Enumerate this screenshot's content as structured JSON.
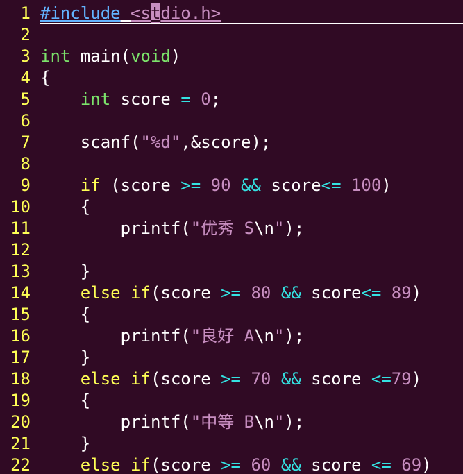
{
  "editor": {
    "lines": [
      {
        "num": "1",
        "cursorline": true,
        "tokens": [
          {
            "t": "#include",
            "k": "preproc",
            "ul": true
          },
          {
            "t": " ",
            "k": "plain",
            "ul": true
          },
          {
            "t": "<s",
            "k": "include",
            "ul": true
          },
          {
            "t": "t",
            "k": "cursor",
            "ul": true
          },
          {
            "t": "dio.h>",
            "k": "include",
            "ul": true
          }
        ]
      },
      {
        "num": "2",
        "tokens": []
      },
      {
        "num": "3",
        "tokens": [
          {
            "t": "int",
            "k": "type"
          },
          {
            "t": " main(",
            "k": "plain"
          },
          {
            "t": "void",
            "k": "type"
          },
          {
            "t": ")",
            "k": "plain"
          }
        ]
      },
      {
        "num": "4",
        "tokens": [
          {
            "t": "{",
            "k": "plain"
          }
        ]
      },
      {
        "num": "5",
        "tokens": [
          {
            "t": "    ",
            "k": "plain"
          },
          {
            "t": "int",
            "k": "type"
          },
          {
            "t": " score ",
            "k": "plain"
          },
          {
            "t": "=",
            "k": "operator"
          },
          {
            "t": " ",
            "k": "plain"
          },
          {
            "t": "0",
            "k": "number"
          },
          {
            "t": ";",
            "k": "plain"
          }
        ]
      },
      {
        "num": "6",
        "tokens": []
      },
      {
        "num": "7",
        "tokens": [
          {
            "t": "    scanf(",
            "k": "plain"
          },
          {
            "t": "\"%d\"",
            "k": "string"
          },
          {
            "t": ",&score);",
            "k": "plain"
          }
        ]
      },
      {
        "num": "8",
        "tokens": []
      },
      {
        "num": "9",
        "tokens": [
          {
            "t": "    ",
            "k": "plain"
          },
          {
            "t": "if",
            "k": "keyword"
          },
          {
            "t": " (score ",
            "k": "plain"
          },
          {
            "t": ">=",
            "k": "operator"
          },
          {
            "t": " ",
            "k": "plain"
          },
          {
            "t": "90",
            "k": "number"
          },
          {
            "t": " ",
            "k": "plain"
          },
          {
            "t": "&&",
            "k": "operator"
          },
          {
            "t": " score",
            "k": "plain"
          },
          {
            "t": "<=",
            "k": "operator"
          },
          {
            "t": " ",
            "k": "plain"
          },
          {
            "t": "100",
            "k": "number"
          },
          {
            "t": ")",
            "k": "plain"
          }
        ]
      },
      {
        "num": "10",
        "tokens": [
          {
            "t": "    {",
            "k": "plain"
          }
        ]
      },
      {
        "num": "11",
        "tokens": [
          {
            "t": "        printf(",
            "k": "plain"
          },
          {
            "t": "\"优秀 S",
            "k": "string"
          },
          {
            "t": "\\n",
            "k": "special"
          },
          {
            "t": "\"",
            "k": "string"
          },
          {
            "t": ");",
            "k": "plain"
          }
        ]
      },
      {
        "num": "12",
        "tokens": []
      },
      {
        "num": "13",
        "tokens": [
          {
            "t": "    }",
            "k": "plain"
          }
        ]
      },
      {
        "num": "14",
        "tokens": [
          {
            "t": "    ",
            "k": "plain"
          },
          {
            "t": "else",
            "k": "keyword"
          },
          {
            "t": " ",
            "k": "plain"
          },
          {
            "t": "if",
            "k": "keyword"
          },
          {
            "t": "(score ",
            "k": "plain"
          },
          {
            "t": ">=",
            "k": "operator"
          },
          {
            "t": " ",
            "k": "plain"
          },
          {
            "t": "80",
            "k": "number"
          },
          {
            "t": " ",
            "k": "plain"
          },
          {
            "t": "&&",
            "k": "operator"
          },
          {
            "t": " score",
            "k": "plain"
          },
          {
            "t": "<=",
            "k": "operator"
          },
          {
            "t": " ",
            "k": "plain"
          },
          {
            "t": "89",
            "k": "number"
          },
          {
            "t": ")",
            "k": "plain"
          }
        ]
      },
      {
        "num": "15",
        "tokens": [
          {
            "t": "    {",
            "k": "plain"
          }
        ]
      },
      {
        "num": "16",
        "tokens": [
          {
            "t": "        printf(",
            "k": "plain"
          },
          {
            "t": "\"良好 A",
            "k": "string"
          },
          {
            "t": "\\n",
            "k": "special"
          },
          {
            "t": "\"",
            "k": "string"
          },
          {
            "t": ");",
            "k": "plain"
          }
        ]
      },
      {
        "num": "17",
        "tokens": [
          {
            "t": "    }",
            "k": "plain"
          }
        ]
      },
      {
        "num": "18",
        "tokens": [
          {
            "t": "    ",
            "k": "plain"
          },
          {
            "t": "else",
            "k": "keyword"
          },
          {
            "t": " ",
            "k": "plain"
          },
          {
            "t": "if",
            "k": "keyword"
          },
          {
            "t": "(score ",
            "k": "plain"
          },
          {
            "t": ">=",
            "k": "operator"
          },
          {
            "t": " ",
            "k": "plain"
          },
          {
            "t": "70",
            "k": "number"
          },
          {
            "t": " ",
            "k": "plain"
          },
          {
            "t": "&&",
            "k": "operator"
          },
          {
            "t": " score ",
            "k": "plain"
          },
          {
            "t": "<=",
            "k": "operator"
          },
          {
            "t": "79",
            "k": "number"
          },
          {
            "t": ")",
            "k": "plain"
          }
        ]
      },
      {
        "num": "19",
        "tokens": [
          {
            "t": "    {",
            "k": "plain"
          }
        ]
      },
      {
        "num": "20",
        "tokens": [
          {
            "t": "        printf(",
            "k": "plain"
          },
          {
            "t": "\"中等 B",
            "k": "string"
          },
          {
            "t": "\\n",
            "k": "special"
          },
          {
            "t": "\"",
            "k": "string"
          },
          {
            "t": ");",
            "k": "plain"
          }
        ]
      },
      {
        "num": "21",
        "tokens": [
          {
            "t": "    }",
            "k": "plain"
          }
        ]
      },
      {
        "num": "22",
        "tokens": [
          {
            "t": "    ",
            "k": "plain"
          },
          {
            "t": "else",
            "k": "keyword"
          },
          {
            "t": " ",
            "k": "plain"
          },
          {
            "t": "if",
            "k": "keyword"
          },
          {
            "t": "(score ",
            "k": "plain"
          },
          {
            "t": ">=",
            "k": "operator"
          },
          {
            "t": " ",
            "k": "plain"
          },
          {
            "t": "60",
            "k": "number"
          },
          {
            "t": " ",
            "k": "plain"
          },
          {
            "t": "&&",
            "k": "operator"
          },
          {
            "t": " score ",
            "k": "plain"
          },
          {
            "t": "<=",
            "k": "operator"
          },
          {
            "t": " ",
            "k": "plain"
          },
          {
            "t": "69",
            "k": "number"
          },
          {
            "t": ")",
            "k": "plain"
          }
        ]
      }
    ]
  },
  "colors": {
    "background": "#300a24",
    "line_number": "#ffff55",
    "preproc": "#63b3ff",
    "type": "#7ce36b",
    "keyword": "#ffff55",
    "operator": "#34e2e2",
    "constant": "#c78ec0",
    "text": "#ffffff"
  }
}
